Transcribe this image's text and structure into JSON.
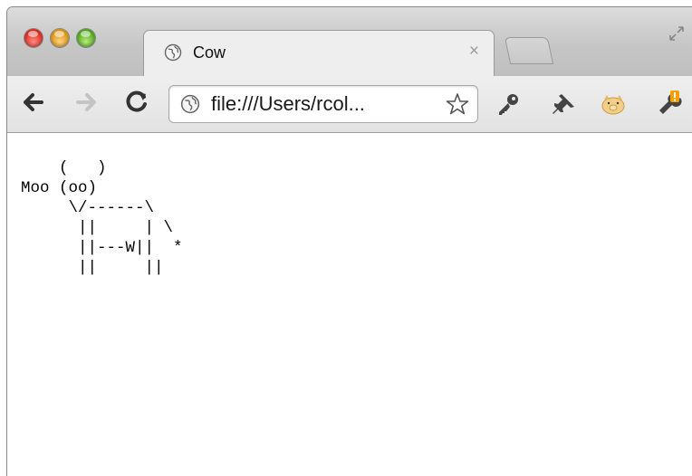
{
  "browser": {
    "tab": {
      "title": "Cow",
      "close_symbol": "×"
    },
    "address_bar": {
      "url": "file:///Users/rcol..."
    },
    "icons": {
      "tab_favicon": "globe-icon",
      "address_favicon": "globe-icon",
      "back": "back-arrow-icon",
      "forward": "forward-arrow-icon",
      "reload": "reload-icon",
      "bookmark": "star-icon",
      "extensions": [
        "key-icon",
        "pushpin-icon",
        "pig-icon",
        "wrench-icon"
      ]
    },
    "colors": {
      "close": "#d8281c",
      "minimize": "#d9920f",
      "maximize": "#4ca41a",
      "wrench_badge": "#f5a000"
    }
  },
  "page": {
    "cow_ascii": "    (   )\nMoo (oo)\n     \\/------\\\n      ||     | \\\n      ||---W||  *\n      ||     ||"
  }
}
